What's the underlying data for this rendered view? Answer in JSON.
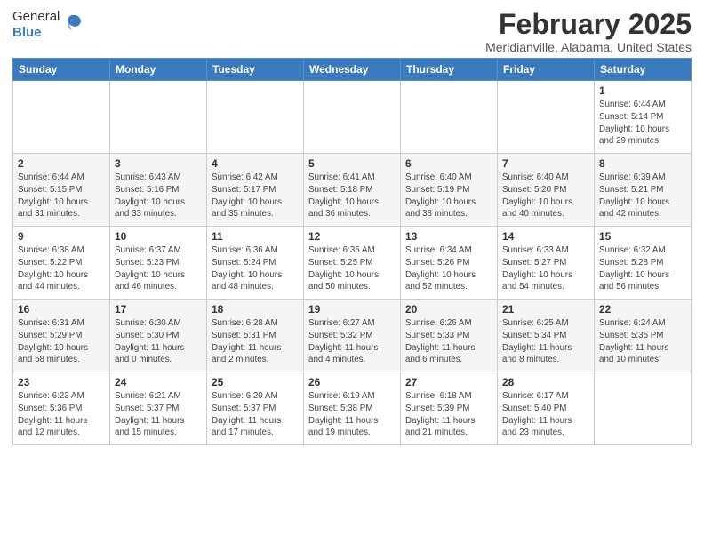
{
  "logo": {
    "general": "General",
    "blue": "Blue"
  },
  "header": {
    "month": "February 2025",
    "location": "Meridianville, Alabama, United States"
  },
  "weekdays": [
    "Sunday",
    "Monday",
    "Tuesday",
    "Wednesday",
    "Thursday",
    "Friday",
    "Saturday"
  ],
  "weeks": [
    [
      {
        "day": "",
        "info": ""
      },
      {
        "day": "",
        "info": ""
      },
      {
        "day": "",
        "info": ""
      },
      {
        "day": "",
        "info": ""
      },
      {
        "day": "",
        "info": ""
      },
      {
        "day": "",
        "info": ""
      },
      {
        "day": "1",
        "info": "Sunrise: 6:44 AM\nSunset: 5:14 PM\nDaylight: 10 hours\nand 29 minutes."
      }
    ],
    [
      {
        "day": "2",
        "info": "Sunrise: 6:44 AM\nSunset: 5:15 PM\nDaylight: 10 hours\nand 31 minutes."
      },
      {
        "day": "3",
        "info": "Sunrise: 6:43 AM\nSunset: 5:16 PM\nDaylight: 10 hours\nand 33 minutes."
      },
      {
        "day": "4",
        "info": "Sunrise: 6:42 AM\nSunset: 5:17 PM\nDaylight: 10 hours\nand 35 minutes."
      },
      {
        "day": "5",
        "info": "Sunrise: 6:41 AM\nSunset: 5:18 PM\nDaylight: 10 hours\nand 36 minutes."
      },
      {
        "day": "6",
        "info": "Sunrise: 6:40 AM\nSunset: 5:19 PM\nDaylight: 10 hours\nand 38 minutes."
      },
      {
        "day": "7",
        "info": "Sunrise: 6:40 AM\nSunset: 5:20 PM\nDaylight: 10 hours\nand 40 minutes."
      },
      {
        "day": "8",
        "info": "Sunrise: 6:39 AM\nSunset: 5:21 PM\nDaylight: 10 hours\nand 42 minutes."
      }
    ],
    [
      {
        "day": "9",
        "info": "Sunrise: 6:38 AM\nSunset: 5:22 PM\nDaylight: 10 hours\nand 44 minutes."
      },
      {
        "day": "10",
        "info": "Sunrise: 6:37 AM\nSunset: 5:23 PM\nDaylight: 10 hours\nand 46 minutes."
      },
      {
        "day": "11",
        "info": "Sunrise: 6:36 AM\nSunset: 5:24 PM\nDaylight: 10 hours\nand 48 minutes."
      },
      {
        "day": "12",
        "info": "Sunrise: 6:35 AM\nSunset: 5:25 PM\nDaylight: 10 hours\nand 50 minutes."
      },
      {
        "day": "13",
        "info": "Sunrise: 6:34 AM\nSunset: 5:26 PM\nDaylight: 10 hours\nand 52 minutes."
      },
      {
        "day": "14",
        "info": "Sunrise: 6:33 AM\nSunset: 5:27 PM\nDaylight: 10 hours\nand 54 minutes."
      },
      {
        "day": "15",
        "info": "Sunrise: 6:32 AM\nSunset: 5:28 PM\nDaylight: 10 hours\nand 56 minutes."
      }
    ],
    [
      {
        "day": "16",
        "info": "Sunrise: 6:31 AM\nSunset: 5:29 PM\nDaylight: 10 hours\nand 58 minutes."
      },
      {
        "day": "17",
        "info": "Sunrise: 6:30 AM\nSunset: 5:30 PM\nDaylight: 11 hours\nand 0 minutes."
      },
      {
        "day": "18",
        "info": "Sunrise: 6:28 AM\nSunset: 5:31 PM\nDaylight: 11 hours\nand 2 minutes."
      },
      {
        "day": "19",
        "info": "Sunrise: 6:27 AM\nSunset: 5:32 PM\nDaylight: 11 hours\nand 4 minutes."
      },
      {
        "day": "20",
        "info": "Sunrise: 6:26 AM\nSunset: 5:33 PM\nDaylight: 11 hours\nand 6 minutes."
      },
      {
        "day": "21",
        "info": "Sunrise: 6:25 AM\nSunset: 5:34 PM\nDaylight: 11 hours\nand 8 minutes."
      },
      {
        "day": "22",
        "info": "Sunrise: 6:24 AM\nSunset: 5:35 PM\nDaylight: 11 hours\nand 10 minutes."
      }
    ],
    [
      {
        "day": "23",
        "info": "Sunrise: 6:23 AM\nSunset: 5:36 PM\nDaylight: 11 hours\nand 12 minutes."
      },
      {
        "day": "24",
        "info": "Sunrise: 6:21 AM\nSunset: 5:37 PM\nDaylight: 11 hours\nand 15 minutes."
      },
      {
        "day": "25",
        "info": "Sunrise: 6:20 AM\nSunset: 5:37 PM\nDaylight: 11 hours\nand 17 minutes."
      },
      {
        "day": "26",
        "info": "Sunrise: 6:19 AM\nSunset: 5:38 PM\nDaylight: 11 hours\nand 19 minutes."
      },
      {
        "day": "27",
        "info": "Sunrise: 6:18 AM\nSunset: 5:39 PM\nDaylight: 11 hours\nand 21 minutes."
      },
      {
        "day": "28",
        "info": "Sunrise: 6:17 AM\nSunset: 5:40 PM\nDaylight: 11 hours\nand 23 minutes."
      },
      {
        "day": "",
        "info": ""
      }
    ]
  ]
}
